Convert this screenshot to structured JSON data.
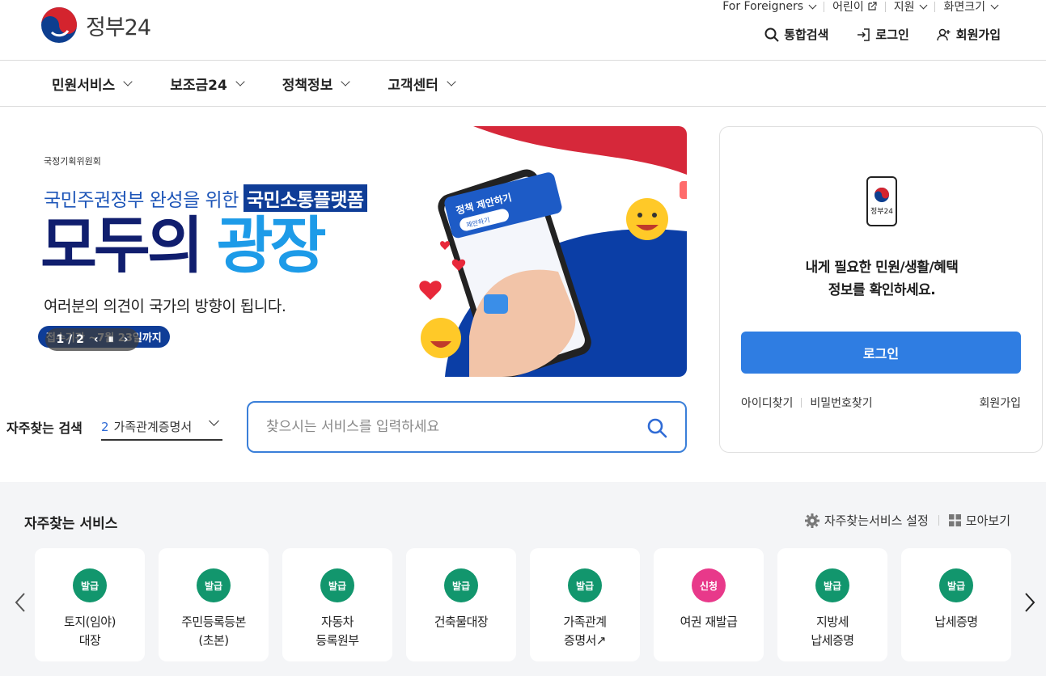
{
  "header": {
    "logo_text": "정부24",
    "util": [
      {
        "label": "For Foreigners",
        "kind": "dropdown"
      },
      {
        "label": "어린이",
        "kind": "external"
      },
      {
        "label": "지원",
        "kind": "dropdown"
      },
      {
        "label": "화면크기",
        "kind": "dropdown"
      }
    ],
    "topnav": [
      {
        "label": "통합검색",
        "icon": "search-icon"
      },
      {
        "label": "로그인",
        "icon": "login-icon"
      },
      {
        "label": "회원가입",
        "icon": "user-plus-icon"
      }
    ]
  },
  "gnb": [
    "민원서비스",
    "보조금24",
    "정책정보",
    "고객센터"
  ],
  "banner": {
    "org": "국정기획위원회",
    "line1_prefix": "국민주권정부 완성을 위한",
    "line1_highlight": "국민소통플랫폼",
    "big_a": "모두의",
    "big_b": "광장",
    "sub": "여러분의 의견이 국가의 방향이 됩니다.",
    "period": "접수기간 ~7월 23일까지",
    "slide_counter": "1 / 2",
    "phone_card_title": "정책 제안하기",
    "phone_card_button": "제안하기"
  },
  "search": {
    "label": "자주찾는 검색",
    "selected_num": "2",
    "selected_text": "가족관계증명서",
    "placeholder": "찾으시는 서비스를 입력하세요"
  },
  "login_card": {
    "phone_label": "정부24",
    "message_line1": "내게 필요한 민원/생활/혜택",
    "message_line2": "정보를 확인하세요.",
    "login_button": "로그인",
    "find_id": "아이디찾기",
    "find_pw": "비밀번호찾기",
    "signup": "회원가입"
  },
  "services": {
    "title": "자주찾는 서비스",
    "settings_label": "자주찾는서비스 설정",
    "view_all_label": "모아보기",
    "colors": {
      "issue": "#12966d",
      "apply": "#e8398a"
    },
    "items": [
      {
        "badge": "발급",
        "type": "issue",
        "name": "토지(임야)\n대장"
      },
      {
        "badge": "발급",
        "type": "issue",
        "name": "주민등록등본\n(초본)"
      },
      {
        "badge": "발급",
        "type": "issue",
        "name": "자동차\n등록원부"
      },
      {
        "badge": "발급",
        "type": "issue",
        "name": "건축물대장"
      },
      {
        "badge": "발급",
        "type": "issue",
        "name": "가족관계\n증명서↗"
      },
      {
        "badge": "신청",
        "type": "apply",
        "name": "여권 재발급"
      },
      {
        "badge": "발급",
        "type": "issue",
        "name": "지방세\n납세증명"
      },
      {
        "badge": "발급",
        "type": "issue",
        "name": "납세증명"
      }
    ]
  }
}
